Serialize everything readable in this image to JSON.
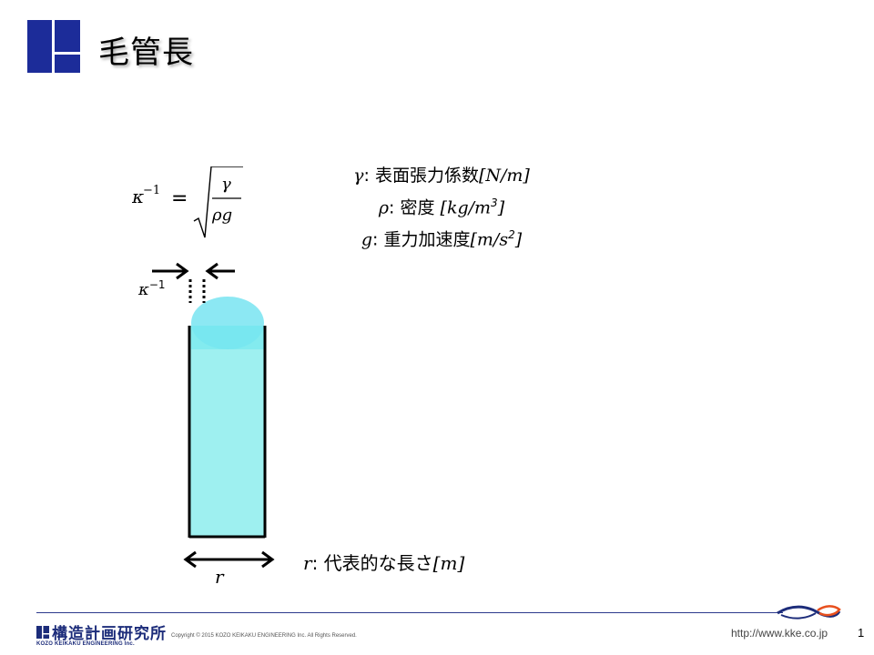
{
  "slide": {
    "title": "毛管長",
    "page_number": "1"
  },
  "formula": {
    "lhs_symbol": "κ",
    "lhs_exponent": "−1",
    "equals": "=",
    "numerator": "γ",
    "denominator": "ρg"
  },
  "definitions": [
    {
      "symbol": "γ",
      "text": ": 表面張力係数",
      "unit": "[N/m]"
    },
    {
      "symbol": "ρ",
      "text": ": 密度 ",
      "unit": "[kg/m",
      "unit_sup": "3",
      "unit_end": "]"
    },
    {
      "symbol": "g",
      "text": ": 重力加速度",
      "unit": "[m/s",
      "unit_sup": "2",
      "unit_end": "]"
    }
  ],
  "figure": {
    "kappa_label": "κ",
    "kappa_exponent": "−1",
    "r_label": "r",
    "r_definition_symbol": "r",
    "r_definition_text": ": 代表的な長さ",
    "r_definition_unit": "[m]",
    "fluid_color": "#9ef0f0",
    "meniscus_color": "#7fe6f2"
  },
  "footer": {
    "company_kanji": "構造計画研究所",
    "company_english": "KOZO KEIKAKU ENGINEERING Inc.",
    "copyright": "Copyright © 2015 KOZO KEIKAKU ENGINEERING Inc. All Rights Reserved.",
    "url": "http://www.kke.co.jp",
    "brand_color": "#1c2c7a"
  }
}
